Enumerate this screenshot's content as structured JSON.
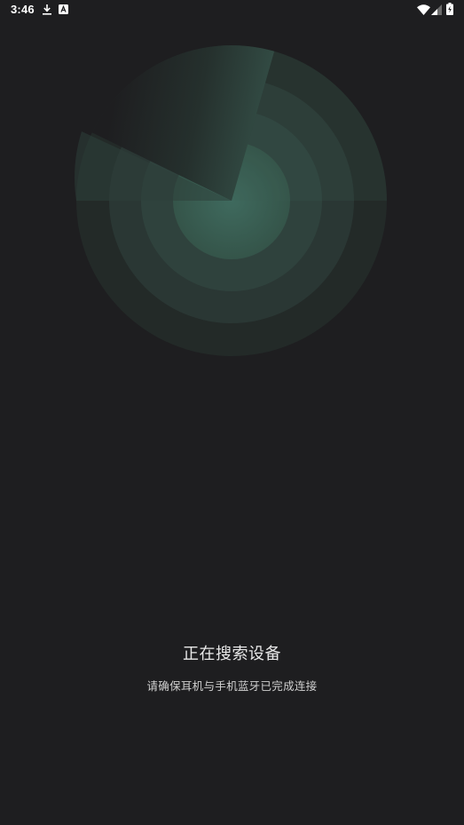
{
  "status_bar": {
    "time": "3:46",
    "icons_left": [
      "download-icon",
      "app-notification-icon"
    ],
    "icons_right": [
      "wifi-icon",
      "cellular-signal-icon",
      "battery-charging-icon"
    ]
  },
  "radar": {
    "state": "scanning",
    "accent_color": "#3f6a5e"
  },
  "search": {
    "title": "正在搜索设备",
    "hint": "请确保耳机与手机蓝牙已完成连接"
  }
}
